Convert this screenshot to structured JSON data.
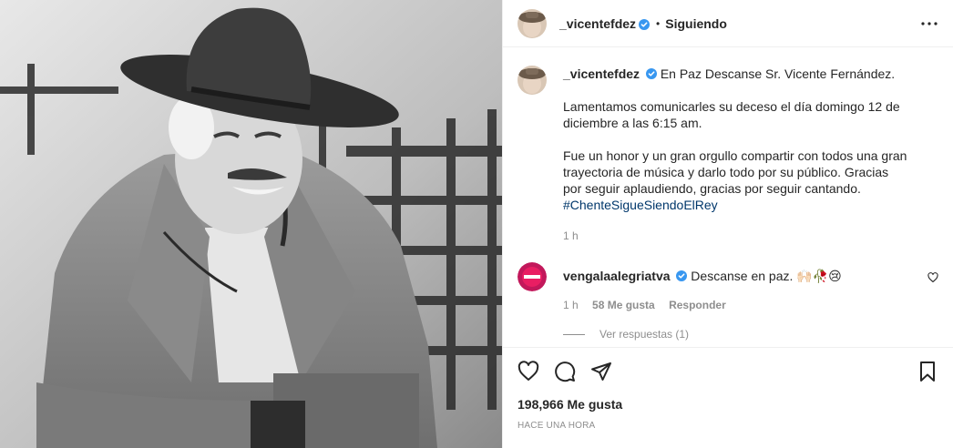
{
  "post": {
    "username": "_vicentefdez",
    "follow_separator": "•",
    "follow_label": "Siguiendo",
    "more_icon": "more-options-icon"
  },
  "caption": {
    "username": "_vicentefdez",
    "line1": "En Paz Descanse Sr. Vicente Fernández.",
    "para2": "Lamentamos comunicarles su deceso el día domingo 12 de diciembre a las 6:15 am.",
    "para3": "Fue un honor y un gran orgullo compartir con todos una gran trayectoria de música y darlo todo por su público. Gracias por seguir aplaudiendo, gracias por seguir cantando.",
    "hashtag": "#ChenteSigueSiendoElRey",
    "time": "1 h"
  },
  "comment": {
    "username": "vengalaalegriatva",
    "text": "Descanse en paz.",
    "emojis": "🙌🏻🥀😢",
    "time": "1 h",
    "likes": "58 Me gusta",
    "reply_label": "Responder",
    "view_replies": "Ver respuestas (1)"
  },
  "footer": {
    "likes": "198,966 Me gusta",
    "time_ago": "HACE UNA HORA"
  },
  "colors": {
    "verified": "#3897f0",
    "link": "#00376b",
    "muted": "#8e8e8e",
    "text": "#262626",
    "comment_avatar": "#c2185b"
  }
}
